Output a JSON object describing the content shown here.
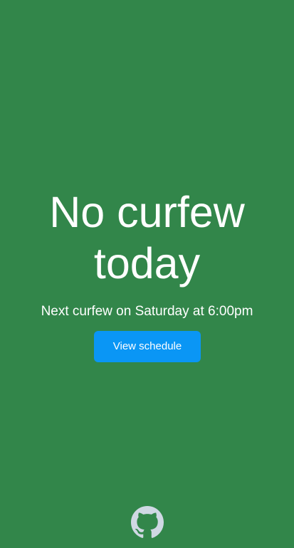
{
  "status": {
    "headline_line1": "No curfew",
    "headline_line2": "today",
    "next_curfew": "Next curfew on Saturday at 6:00pm"
  },
  "actions": {
    "view_schedule_label": "View schedule"
  },
  "footer": {
    "icon": "github-icon"
  },
  "colors": {
    "background": "#32864a",
    "button": "#0a96f5",
    "text": "#ffffff",
    "icon": "#cfd8e3"
  }
}
